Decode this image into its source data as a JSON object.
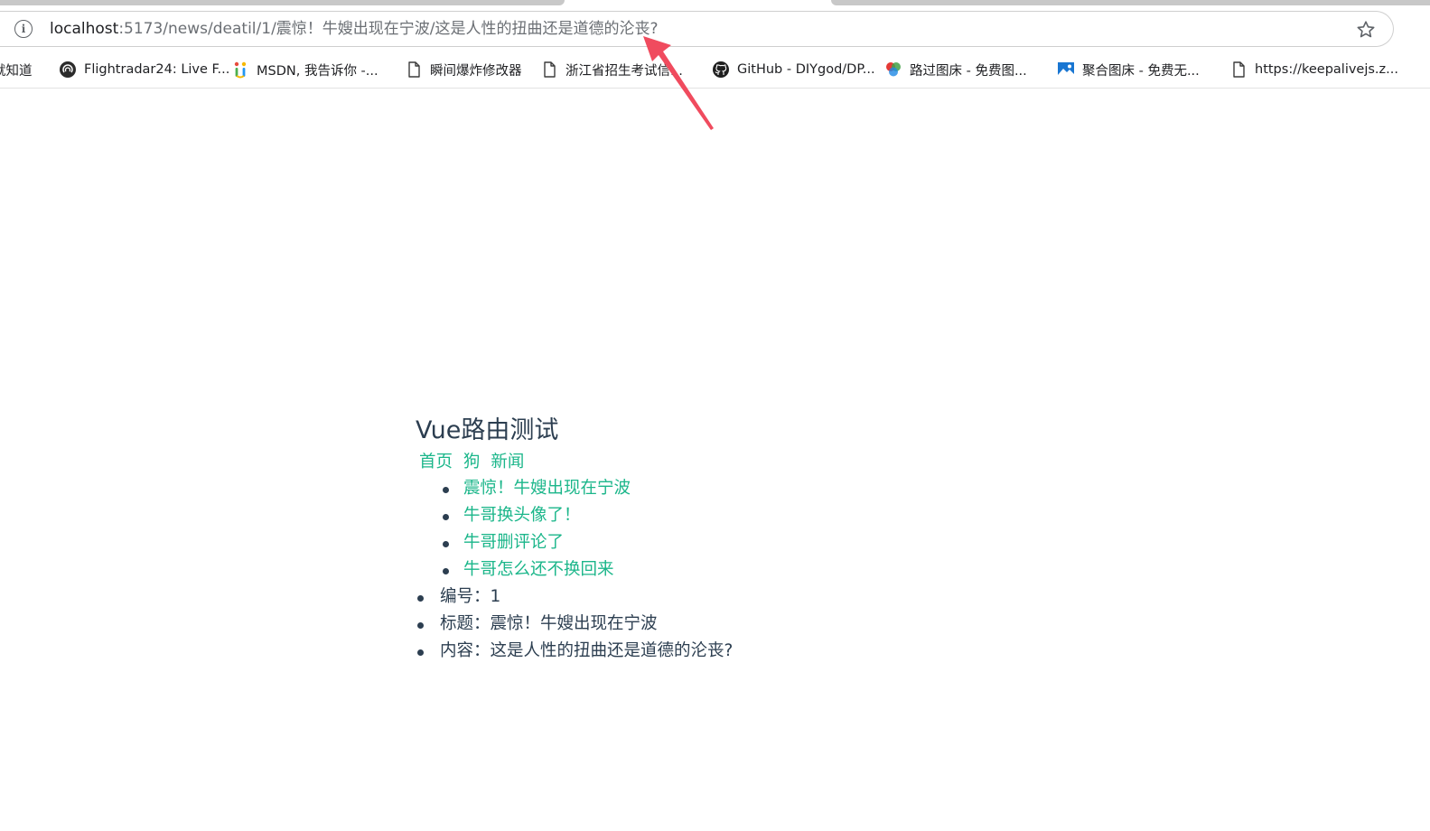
{
  "browser": {
    "url_host": "localhost",
    "url_path": ":5173/news/deatil/1/震惊！牛嫂出现在宁波/这是人性的扭曲还是道德的沦丧?"
  },
  "bookmarks": [
    {
      "label": "就知道",
      "icon": "text-fragment"
    },
    {
      "label": "Flightradar24: Live F...",
      "icon": "flightradar-icon"
    },
    {
      "label": "MSDN, 我告诉你 -...",
      "icon": "msdn-icon"
    },
    {
      "label": "瞬间爆炸修改器",
      "icon": "page-icon"
    },
    {
      "label": "浙江省招生考试信...",
      "icon": "page-icon"
    },
    {
      "label": "GitHub - DIYgod/DP...",
      "icon": "github-icon"
    },
    {
      "label": "路过图床 - 免费图...",
      "icon": "imgbed-icon"
    },
    {
      "label": "聚合图床 - 免费无...",
      "icon": "image-icon"
    },
    {
      "label": "https://keepalivejs.z...",
      "icon": "page-icon"
    }
  ],
  "app": {
    "title": "Vue路由测试",
    "nav": [
      "首页",
      "狗",
      "新闻"
    ],
    "news": [
      "震惊！牛嫂出现在宁波",
      "牛哥换头像了！",
      "牛哥删评论了",
      "牛哥怎么还不换回来"
    ],
    "detail": [
      "编号：1",
      "标题：震惊！牛嫂出现在宁波",
      "内容：这是人性的扭曲还是道德的沦丧?"
    ]
  },
  "colors": {
    "link": "#1bb68a",
    "text": "#2c3e50",
    "annotation_arrow": "#f04b5e"
  }
}
